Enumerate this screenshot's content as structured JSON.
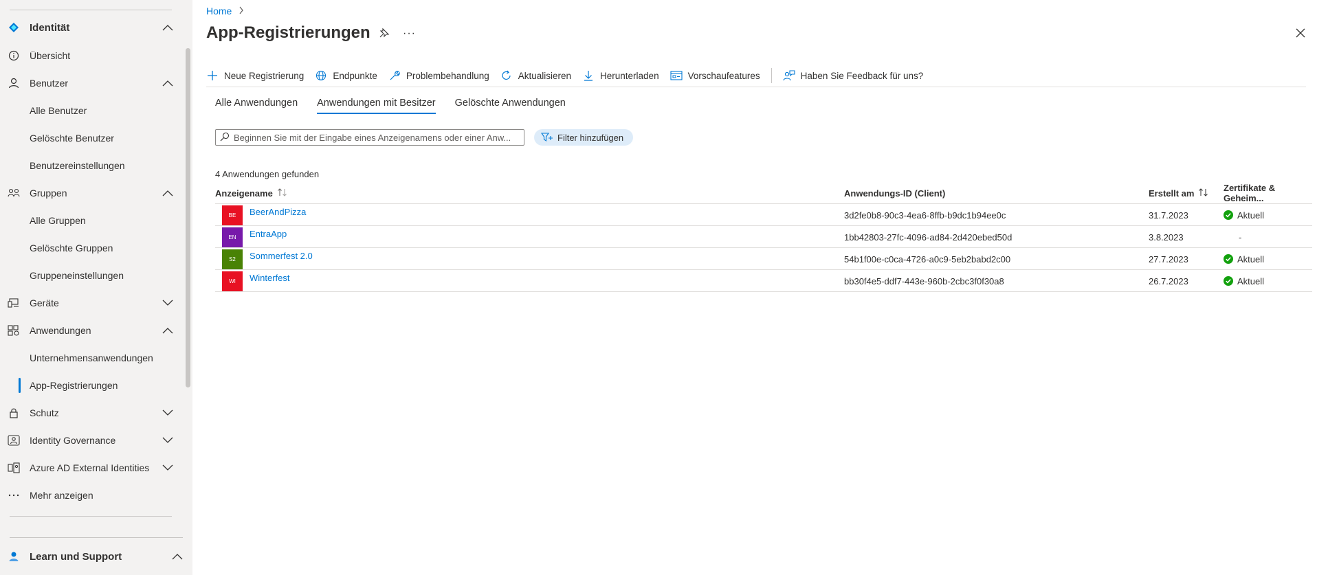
{
  "sidebar": {
    "identity": {
      "label": "Identität"
    },
    "items": [
      {
        "label": "Übersicht"
      },
      {
        "label": "Benutzer"
      },
      {
        "label": "Alle Benutzer"
      },
      {
        "label": "Gelöschte Benutzer"
      },
      {
        "label": "Benutzereinstellungen"
      },
      {
        "label": "Gruppen"
      },
      {
        "label": "Alle Gruppen"
      },
      {
        "label": "Gelöschte Gruppen"
      },
      {
        "label": "Gruppeneinstellungen"
      },
      {
        "label": "Geräte"
      },
      {
        "label": "Anwendungen"
      },
      {
        "label": "Unternehmensanwendungen"
      },
      {
        "label": "App-Registrierungen"
      },
      {
        "label": "Schutz"
      },
      {
        "label": "Identity Governance"
      },
      {
        "label": "Azure AD External Identities"
      },
      {
        "label": "Mehr anzeigen"
      }
    ],
    "learn": {
      "label": "Learn und Support"
    }
  },
  "breadcrumb": {
    "home": "Home"
  },
  "page": {
    "title": "App-Registrierungen",
    "more": "···"
  },
  "toolbar": {
    "new_registration": "Neue Registrierung",
    "endpoints": "Endpunkte",
    "troubleshoot": "Problembehandlung",
    "refresh": "Aktualisieren",
    "download": "Herunterladen",
    "preview": "Vorschaufeatures",
    "feedback": "Haben Sie Feedback für uns?"
  },
  "tabs": [
    {
      "label": "Alle Anwendungen"
    },
    {
      "label": "Anwendungen mit Besitzer"
    },
    {
      "label": "Gelöschte Anwendungen"
    }
  ],
  "search": {
    "placeholder": "Beginnen Sie mit der Eingabe eines Anzeigenamens oder einer Anw...",
    "value": ""
  },
  "filter": {
    "label": "Filter hinzufügen"
  },
  "results": {
    "count": "4 Anwendungen gefunden"
  },
  "table": {
    "headers": {
      "name": "Anzeigename",
      "app_id": "Anwendungs-ID (Client)",
      "created": "Erstellt am",
      "certs": "Zertifikate & Geheim..."
    },
    "rows": [
      {
        "initials": "BE",
        "name": "BeerAndPizza",
        "app_id": "3d2fe0b8-90c3-4ea6-8ffb-b9dc1b94ee0c",
        "created": "31.7.2023",
        "status": "Aktuell",
        "color": "#e81123"
      },
      {
        "initials": "EN",
        "name": "EntraApp",
        "app_id": "1bb42803-27fc-4096-ad84-2d420ebed50d",
        "created": "3.8.2023",
        "status": "-",
        "color": "#7719aa"
      },
      {
        "initials": "S2",
        "name": "Sommerfest 2.0",
        "app_id": "54b1f00e-c0ca-4726-a0c9-5eb2babd2c00",
        "created": "27.7.2023",
        "status": "Aktuell",
        "color": "#498205"
      },
      {
        "initials": "WI",
        "name": "Winterfest",
        "app_id": "bb30f4e5-ddf7-443e-960b-2cbc3f0f30a8",
        "created": "26.7.2023",
        "status": "Aktuell",
        "color": "#e81123"
      }
    ]
  },
  "colors": {
    "accent": "#0078d4",
    "success": "#13a10e"
  }
}
